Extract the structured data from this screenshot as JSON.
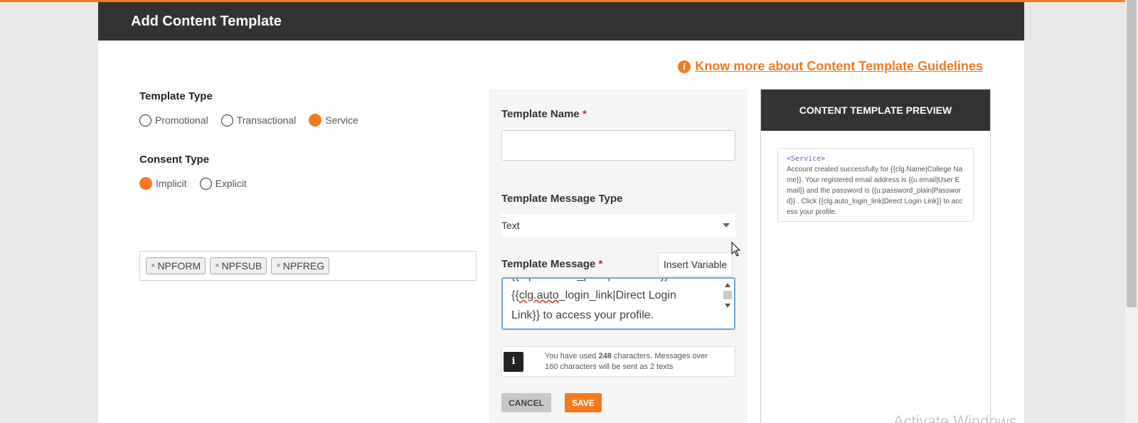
{
  "modal": {
    "title": "Add Content Template",
    "guidelines_link": "Know more about Content Template Guidelines"
  },
  "template_type": {
    "label": "Template Type",
    "options": [
      "Promotional",
      "Transactional",
      "Service"
    ],
    "selected": "Service"
  },
  "consent_type": {
    "label": "Consent Type",
    "options": [
      "Implicit",
      "Explicit"
    ],
    "selected": "Implicit"
  },
  "tags": [
    "NPFORM",
    "NPFSUB",
    "NPFREG"
  ],
  "form": {
    "template_name_label": "Template Name",
    "template_name_value": "",
    "required_mark": "*",
    "message_type_label": "Template Message Type",
    "message_type_value": "Text",
    "message_label": "Template Message",
    "insert_variable": "Insert Variable",
    "message_lines": {
      "line1": "{{u.password_plain|Password}} . Click",
      "line2_pre": "{{",
      "line2_spell": "clg.auto",
      "line2_post": "_login_link|Direct Login",
      "line3": "Link}} to access your profile."
    },
    "char_info_prefix": "You have used",
    "char_count": "248",
    "char_info_suffix": "characters. Messages over 160 characters will be sent as 2 texts",
    "cancel": "CANCEL",
    "save": "SAVE"
  },
  "preview": {
    "header": "CONTENT TEMPLATE PREVIEW",
    "tag": "<Service>",
    "message": "Account created successfully for {{clg.Name|College Name}}. Your registered email address is {{u.email|User Email}} and the password is {{u.password_plain|Password}} . Click {{clg.auto_login_link|Direct Login Link}} to access your profile."
  },
  "watermark": "Activate Windows",
  "colors": {
    "accent": "#f47a20",
    "header_bg": "#333333",
    "required": "#d9231d",
    "focus_border": "#6aa5e8"
  }
}
